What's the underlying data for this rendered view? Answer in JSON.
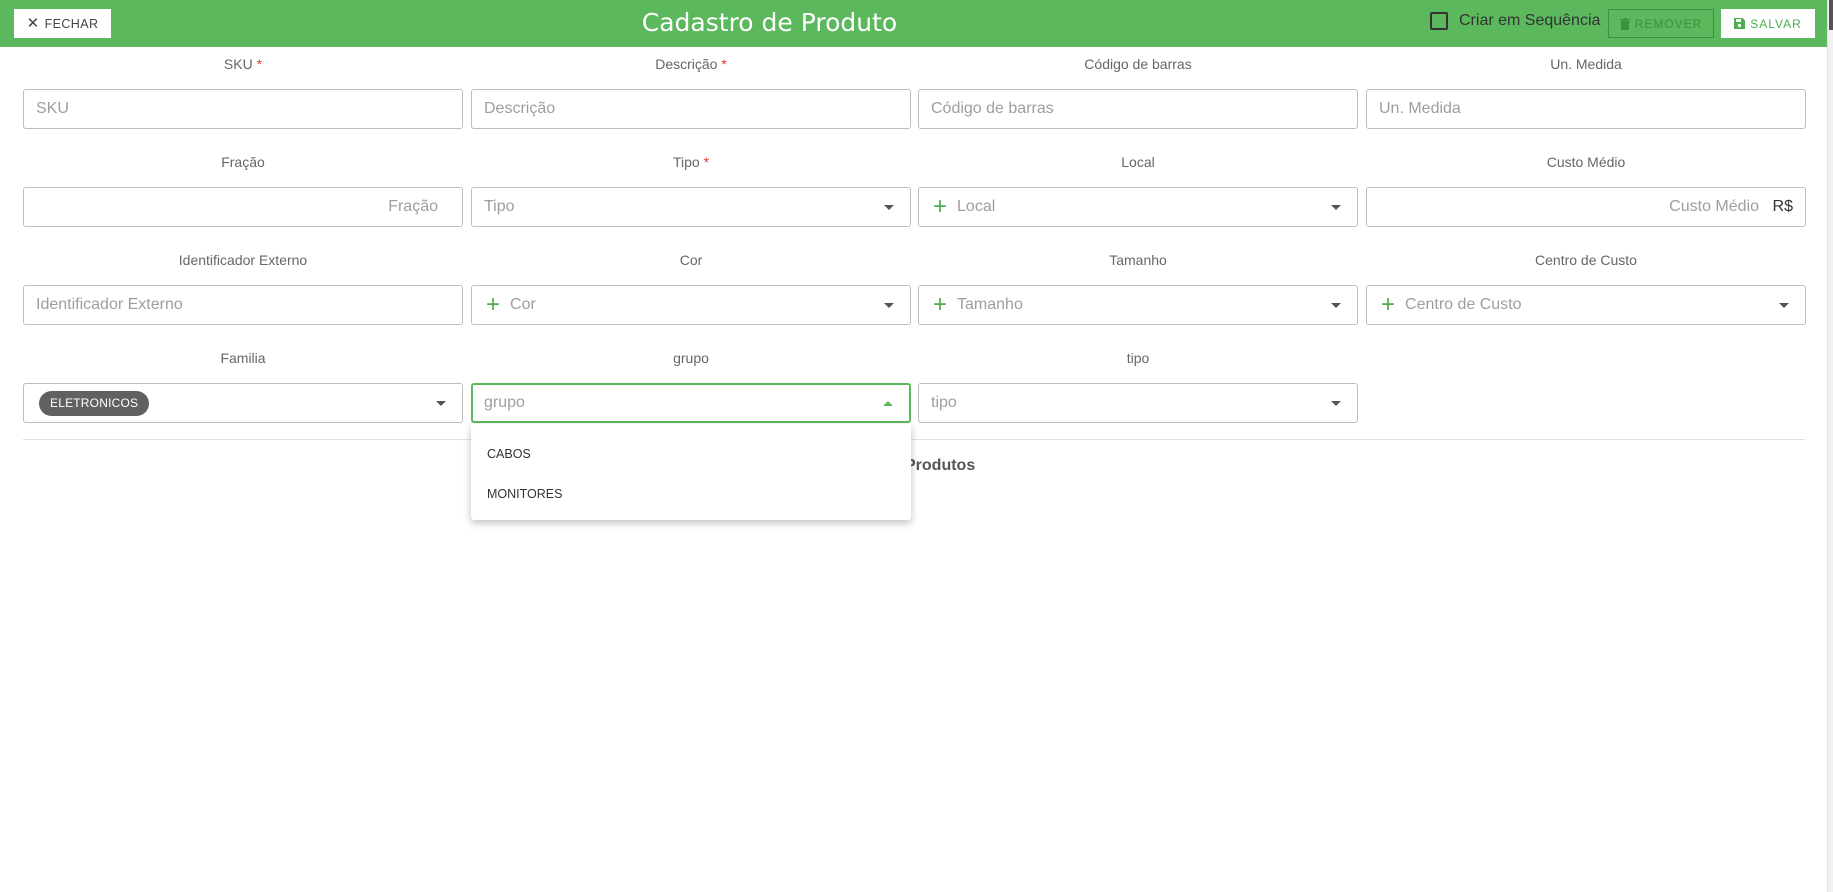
{
  "header": {
    "close_label": "FECHAR",
    "title": "Cadastro de Produto",
    "sequence_label": "Criar em Sequência",
    "remove_label": "REMOVER",
    "save_label": "SALVAR"
  },
  "colors": {
    "accent": "#5cb85c",
    "required": "#e53935",
    "chip": "#616161"
  },
  "form": {
    "sku": {
      "label": "SKU",
      "required_mark": "*",
      "placeholder": "SKU"
    },
    "descricao": {
      "label": "Descrição",
      "required_mark": "*",
      "placeholder": "Descrição"
    },
    "codigo_barras": {
      "label": "Código de barras",
      "placeholder": "Código de barras"
    },
    "un_medida": {
      "label": "Un. Medida",
      "placeholder": "Un. Medida"
    },
    "fracao": {
      "label": "Fração",
      "placeholder": "Fração"
    },
    "tipo": {
      "label": "Tipo",
      "required_mark": "*",
      "placeholder": "Tipo"
    },
    "local": {
      "label": "Local",
      "placeholder": "Local",
      "add_icon": "plus-icon"
    },
    "custo_medio": {
      "label": "Custo Médio",
      "placeholder": "Custo Médio",
      "suffix": "R$"
    },
    "identificador_externo": {
      "label": "Identificador Externo",
      "placeholder": "Identificador Externo"
    },
    "cor": {
      "label": "Cor",
      "placeholder": "Cor",
      "add_icon": "plus-icon"
    },
    "tamanho": {
      "label": "Tamanho",
      "placeholder": "Tamanho",
      "add_icon": "plus-icon"
    },
    "centro_custo": {
      "label": "Centro de Custo",
      "placeholder": "Centro de Custo",
      "add_icon": "plus-icon"
    },
    "familia": {
      "label": "Familia",
      "value_chip": "ELETRONICOS"
    },
    "grupo": {
      "label": "grupo",
      "placeholder": "grupo",
      "options": [
        "CABOS",
        "MONITORES"
      ]
    },
    "tipo2": {
      "label": "tipo",
      "placeholder": "tipo"
    }
  },
  "section": {
    "title_visible": "Produtos"
  }
}
